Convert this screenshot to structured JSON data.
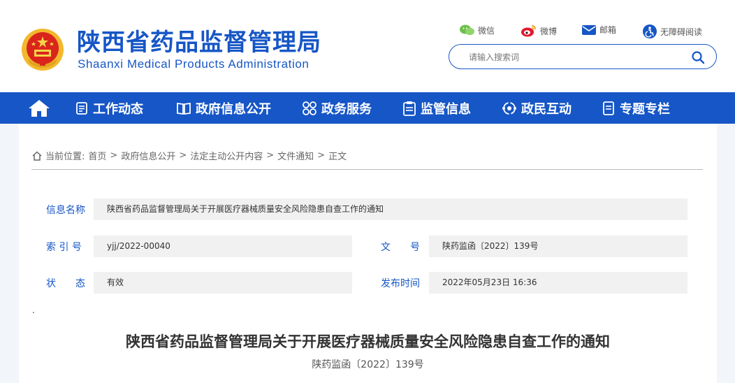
{
  "header": {
    "site_title": "陕西省药品监督管理局",
    "site_subtitle": "Shaanxi Medical Products Administration",
    "quick_links": [
      {
        "label": "微信",
        "icon": "wechat-icon"
      },
      {
        "label": "微博",
        "icon": "weibo-icon"
      },
      {
        "label": "邮箱",
        "icon": "mail-icon"
      },
      {
        "label": "无障碍阅读",
        "icon": "accessibility-icon"
      }
    ],
    "search": {
      "placeholder": "请输入搜索词",
      "value": ""
    }
  },
  "nav": {
    "home_icon": "home-icon",
    "items": [
      {
        "label": "工作动态",
        "icon": "list-icon"
      },
      {
        "label": "政府信息公开",
        "icon": "book-icon"
      },
      {
        "label": "政务服务",
        "icon": "grid-icon"
      },
      {
        "label": "监管信息",
        "icon": "clipboard-icon"
      },
      {
        "label": "政民互动",
        "icon": "interaction-icon"
      },
      {
        "label": "专题专栏",
        "icon": "folder-icon"
      }
    ]
  },
  "breadcrumb": {
    "prefix": "当前位置:",
    "items": [
      "首页",
      "政府信息公开",
      "法定主动公开内容",
      "文件通知",
      "正文"
    ],
    "separator": ">"
  },
  "info": {
    "name_label": "信息名称",
    "name_value": "陕西省药品监督管理局关于开展医疗器械质量安全风险隐患自查工作的通知",
    "index_label": "索 引 号",
    "index_value": "yjj/2022-00040",
    "docno_label": "文　　号",
    "docno_value": "陕药监函〔2022〕139号",
    "status_label": "状　　态",
    "status_value": "有效",
    "date_label": "发布时间",
    "date_value": "2022年05月23日 16:36"
  },
  "article": {
    "dot": ".",
    "title": "陕西省药品监督管理局关于开展医疗器械质量安全风险隐患自查工作的通知",
    "doc_number": "陕药监函〔2022〕139号"
  },
  "colors": {
    "brand": "#1656c6",
    "background": "#f2f5fa",
    "field_bg": "#f1f1f1"
  }
}
